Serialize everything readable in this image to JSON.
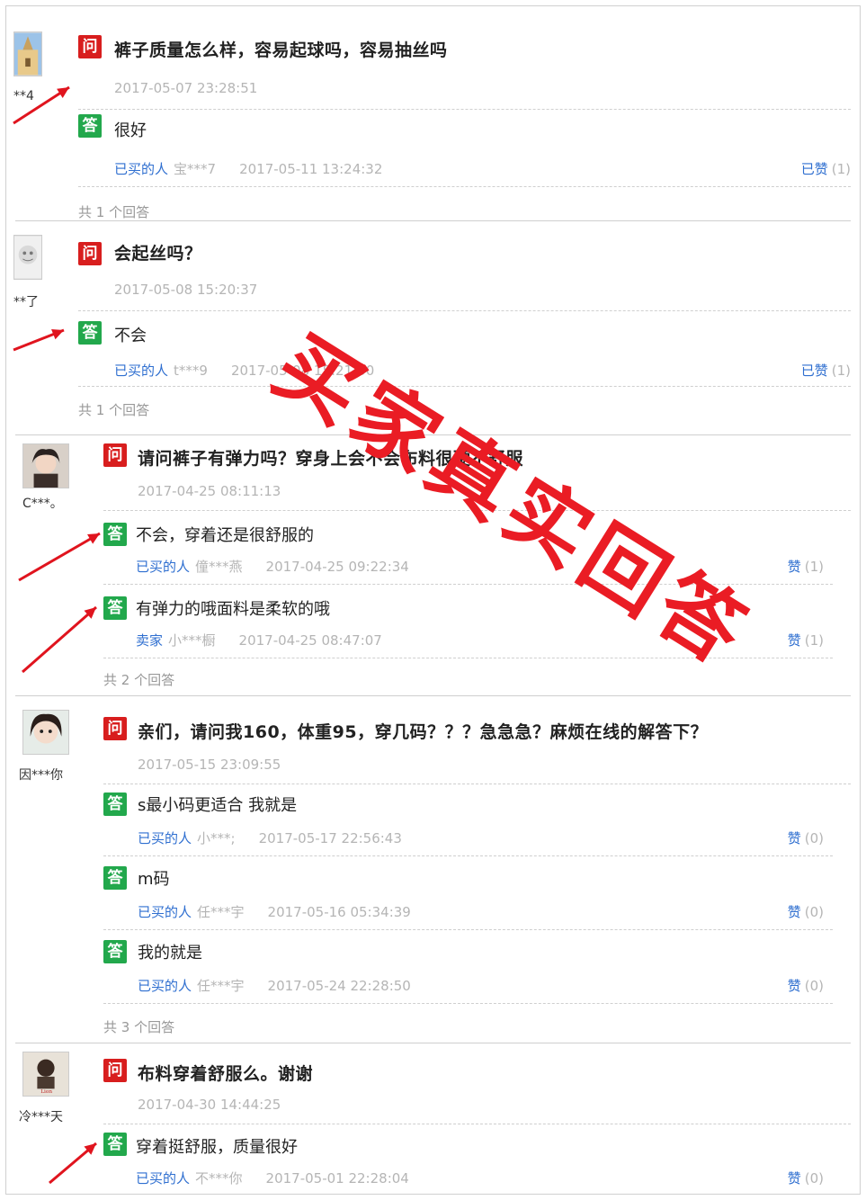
{
  "stamp": "买家真实回答",
  "items": [
    {
      "user": "**4",
      "question": "裤子质量怎么样，容易起球吗，容易抽丝吗",
      "date": "2017-05-07 23:28:51",
      "answers": [
        {
          "text": "很好",
          "role": "已买的人",
          "buyer": "宝***7",
          "date": "2017-05-11 13:24:32",
          "like_label": "已赞",
          "like_count": "(1)"
        }
      ],
      "count": "共 1 个回答"
    },
    {
      "user": "**了",
      "question": "会起丝吗？",
      "date": "2017-05-08 15:20:37",
      "answers": [
        {
          "text": "不会",
          "role": "已买的人",
          "buyer": "t***9",
          "date": "2017-05-08 15:21:30",
          "like_label": "已赞",
          "like_count": "(1)"
        }
      ],
      "count": "共 1 个回答"
    },
    {
      "user": "C***。",
      "question": "请问裤子有弹力吗？穿身上会不会布料很硬不舒服",
      "date": "2017-04-25 08:11:13",
      "answers": [
        {
          "text": "不会，穿着还是很舒服的",
          "role": "已买的人",
          "buyer": "僮***燕",
          "date": "2017-04-25 09:22:34",
          "like_label": "赞",
          "like_count": "(1)"
        },
        {
          "text": "有弹力的哦面料是柔软的哦",
          "role": "卖家",
          "buyer": "小***橱",
          "date": "2017-04-25 08:47:07",
          "like_label": "赞",
          "like_count": "(1)"
        }
      ],
      "count": "共 2 个回答"
    },
    {
      "user": "因***你",
      "question": "亲们，请问我160，体重95，穿几码？？？急急急？麻烦在线的解答下？",
      "date": "2017-05-15 23:09:55",
      "answers": [
        {
          "text": "s最小码更适合 我就是",
          "role": "已买的人",
          "buyer": "小***;",
          "date": "2017-05-17 22:56:43",
          "like_label": "赞",
          "like_count": "(0)"
        },
        {
          "text": "m码",
          "role": "已买的人",
          "buyer": "任***宇",
          "date": "2017-05-16 05:34:39",
          "like_label": "赞",
          "like_count": "(0)"
        },
        {
          "text": "我的就是",
          "role": "已买的人",
          "buyer": "任***宇",
          "date": "2017-05-24 22:28:50",
          "like_label": "赞",
          "like_count": "(0)"
        }
      ],
      "count": "共 3 个回答"
    },
    {
      "user": "冷***天",
      "question": "布料穿着舒服么。谢谢",
      "date": "2017-04-30 14:44:25",
      "answers": [
        {
          "text": "穿着挺舒服，质量很好",
          "role": "已买的人",
          "buyer": "不***你",
          "date": "2017-05-01 22:28:04",
          "like_label": "赞",
          "like_count": "(0)"
        }
      ],
      "count": ""
    }
  ],
  "badges": {
    "question": "问",
    "answer": "答"
  },
  "colors": {
    "question_badge": "#d81e1e",
    "answer_badge": "#22a84c",
    "link": "#2f6fd0",
    "stamp": "#ea1c24"
  }
}
